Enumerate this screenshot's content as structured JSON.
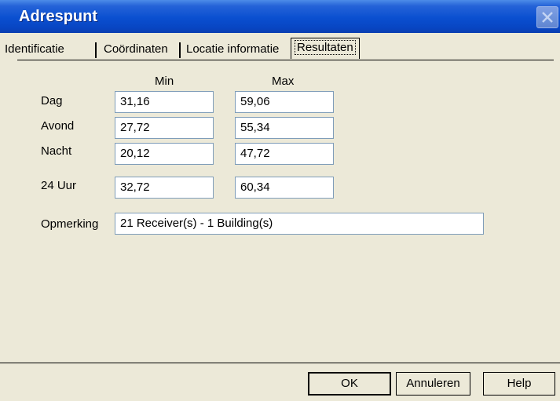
{
  "window": {
    "title": "Adrespunt"
  },
  "tabs": [
    "Identificatie",
    "Coördinaten",
    "Locatie informatie",
    "Resultaten"
  ],
  "active_tab": "Resultaten",
  "columns": {
    "min": "Min",
    "max": "Max"
  },
  "rows": [
    {
      "label": "Dag",
      "min": "31,16",
      "max": "59,06"
    },
    {
      "label": "Avond",
      "min": "27,72",
      "max": "55,34"
    },
    {
      "label": "Nacht",
      "min": "20,12",
      "max": "47,72"
    },
    {
      "label": "24 Uur",
      "min": "32,72",
      "max": "60,34"
    }
  ],
  "remark": {
    "label": "Opmerking",
    "value": "21 Receiver(s) - 1 Building(s)"
  },
  "buttons": {
    "ok": "OK",
    "cancel": "Annuleren",
    "help": "Help"
  }
}
